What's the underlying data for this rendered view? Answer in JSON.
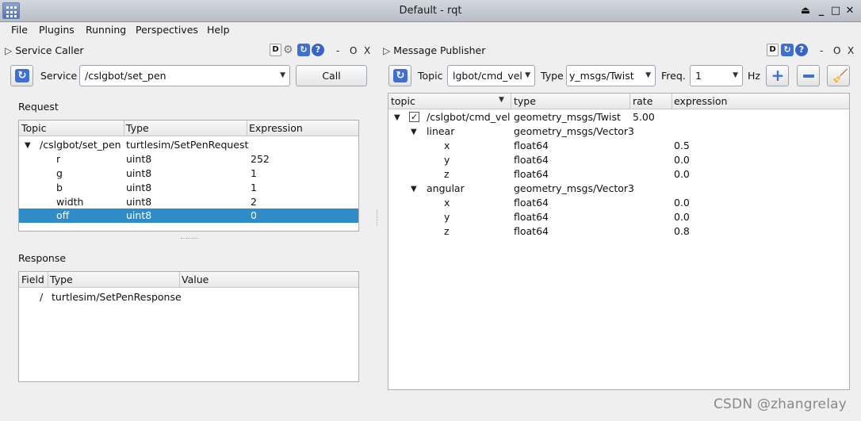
{
  "window": {
    "title": "Default - rqt"
  },
  "menu": [
    {
      "label": "File"
    },
    {
      "label": "Plugins"
    },
    {
      "label": "Running"
    },
    {
      "label": "Perspectives"
    },
    {
      "label": "Help"
    }
  ],
  "service_caller": {
    "title": "Service Caller",
    "dock_ctrls": {
      "minus": "-",
      "o": "O",
      "x": "X"
    },
    "service_label": "Service",
    "service_value": "/cslgbot/set_pen",
    "call_label": "Call",
    "request_title": "Request",
    "request_columns": [
      "Topic",
      "Type",
      "Expression"
    ],
    "request_rows": [
      {
        "topic": "/cslgbot/set_pen",
        "type": "turtlesim/SetPenRequest",
        "expression": ""
      },
      {
        "topic": "r",
        "type": "uint8",
        "expression": "252"
      },
      {
        "topic": "g",
        "type": "uint8",
        "expression": "1"
      },
      {
        "topic": "b",
        "type": "uint8",
        "expression": "1"
      },
      {
        "topic": "width",
        "type": "uint8",
        "expression": "2"
      },
      {
        "topic": "off",
        "type": "uint8",
        "expression": "0"
      }
    ],
    "response_title": "Response",
    "response_columns": [
      "Field",
      "Type",
      "Value"
    ],
    "response_rows": [
      {
        "field": "/",
        "type": "turtlesim/SetPenResponse",
        "value": ""
      }
    ]
  },
  "message_publisher": {
    "title": "Message Publisher",
    "dock_ctrls": {
      "minus": "-",
      "o": "O",
      "x": "X"
    },
    "topic_label": "Topic",
    "topic_value": "lgbot/cmd_vel",
    "type_label": "Type",
    "type_value": "y_msgs/Twist",
    "freq_label": "Freq.",
    "freq_value": "1",
    "hz_label": "Hz",
    "columns": [
      "topic",
      "type",
      "rate",
      "expression"
    ],
    "rows": [
      {
        "topic": "/cslgbot/cmd_vel",
        "type": "geometry_msgs/Twist",
        "rate": "5.00",
        "expression": ""
      },
      {
        "topic": "linear",
        "type": "geometry_msgs/Vector3",
        "rate": "",
        "expression": ""
      },
      {
        "topic": "x",
        "type": "float64",
        "rate": "",
        "expression": "0.5"
      },
      {
        "topic": "y",
        "type": "float64",
        "rate": "",
        "expression": "0.0"
      },
      {
        "topic": "z",
        "type": "float64",
        "rate": "",
        "expression": "0.0"
      },
      {
        "topic": "angular",
        "type": "geometry_msgs/Vector3",
        "rate": "",
        "expression": ""
      },
      {
        "topic": "x",
        "type": "float64",
        "rate": "",
        "expression": "0.0"
      },
      {
        "topic": "y",
        "type": "float64",
        "rate": "",
        "expression": "0.0"
      },
      {
        "topic": "z",
        "type": "float64",
        "rate": "",
        "expression": "0.8"
      }
    ]
  },
  "watermark": "CSDN @zhangrelay",
  "colors": {
    "selection": "#308cc6",
    "accent_icon": "#3f6fcf"
  }
}
